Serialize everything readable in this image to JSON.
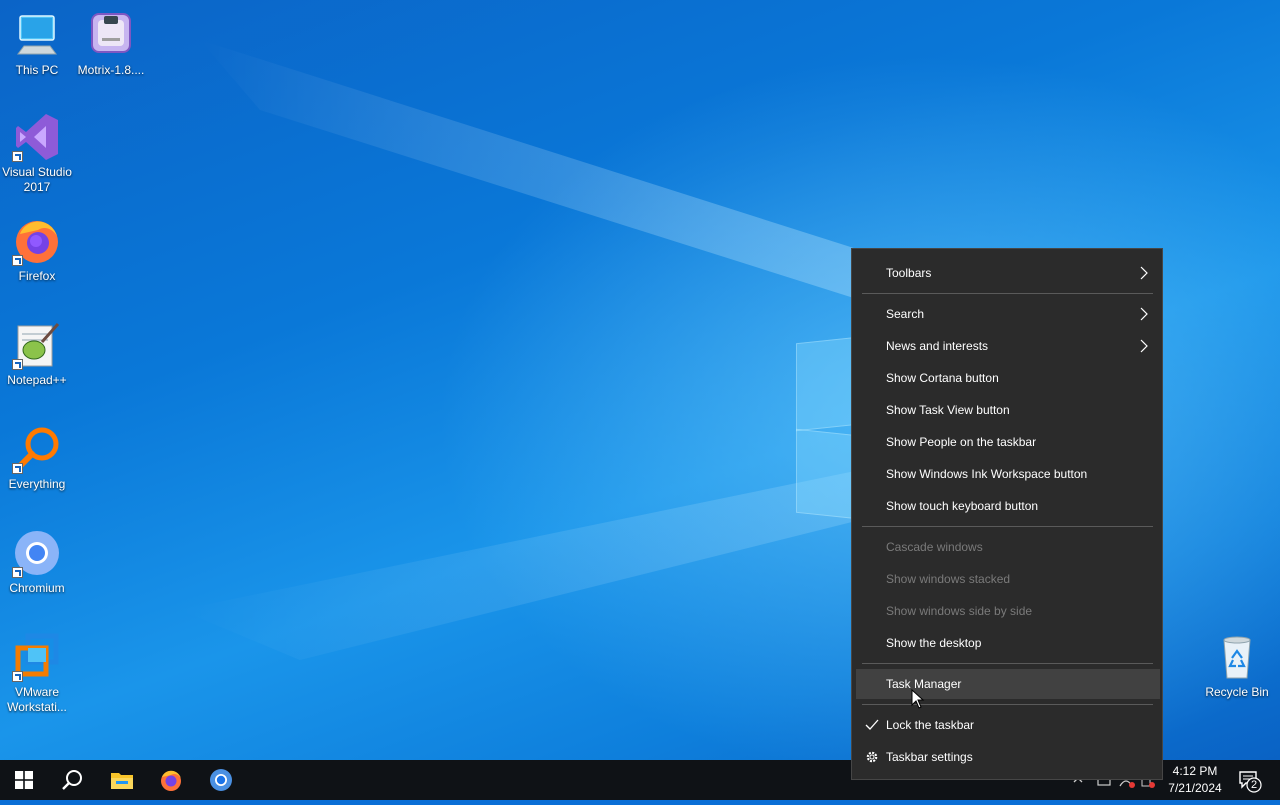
{
  "desktop": {
    "icons": [
      {
        "label": "This PC"
      },
      {
        "label": "Motrix-1.8...."
      },
      {
        "label": "Visual Studio 2017"
      },
      {
        "label": "Firefox"
      },
      {
        "label": "Notepad++"
      },
      {
        "label": "Everything"
      },
      {
        "label": "Chromium"
      },
      {
        "label": "VMware Workstati..."
      },
      {
        "label": "Recycle Bin"
      }
    ]
  },
  "context_menu": {
    "items": [
      {
        "label": "Toolbars",
        "submenu": true
      },
      {
        "label": "Search",
        "submenu": true
      },
      {
        "label": "News and interests",
        "submenu": true
      },
      {
        "label": "Show Cortana button"
      },
      {
        "label": "Show Task View button"
      },
      {
        "label": "Show People on the taskbar"
      },
      {
        "label": "Show Windows Ink Workspace button"
      },
      {
        "label": "Show touch keyboard button"
      },
      {
        "label": "Cascade windows",
        "disabled": true
      },
      {
        "label": "Show windows stacked",
        "disabled": true
      },
      {
        "label": "Show windows side by side",
        "disabled": true
      },
      {
        "label": "Show the desktop"
      },
      {
        "label": "Task Manager",
        "highlighted": true
      },
      {
        "label": "Lock the taskbar",
        "checked": true
      },
      {
        "label": "Taskbar settings",
        "icon": "gear-icon"
      }
    ]
  },
  "taskbar": {
    "buttons": [
      "start-icon",
      "search-icon",
      "file-explorer-icon",
      "firefox-icon",
      "chromium-icon"
    ],
    "clock": {
      "time": "4:12 PM",
      "date": "7/21/2024"
    },
    "notifications_count": "2"
  },
  "colors": {
    "menu_bg": "#2b2b2b",
    "menu_hover": "#414141",
    "taskbar_bg": "#0f1216",
    "disabled_text": "#7a7a7a"
  }
}
